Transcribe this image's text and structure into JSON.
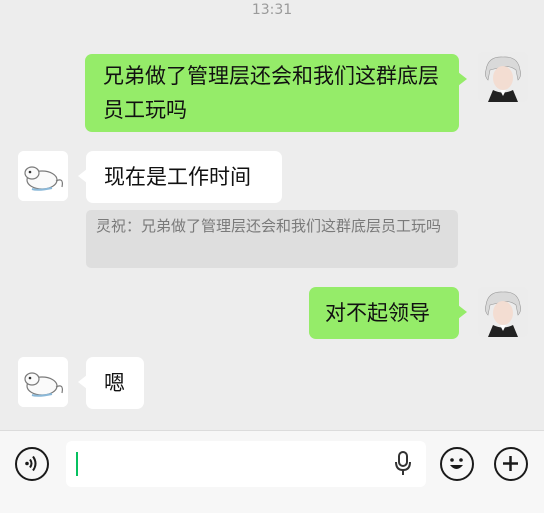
{
  "status_time": "13:31",
  "messages": [
    {
      "side": "right",
      "text": "兄弟做了管理层还会和我们这群底层员工玩吗"
    },
    {
      "side": "left",
      "text": "现在是工作时间"
    },
    {
      "side": "right",
      "text": "对不起领导"
    },
    {
      "side": "left",
      "text": "嗯"
    }
  ],
  "quote": {
    "text": "灵祝：兄弟做了管理层还会和我们这群底层员工玩吗"
  },
  "input_bar": {
    "value": "",
    "icons": [
      "voice-icon",
      "microphone-icon",
      "emoji-icon",
      "plus-icon"
    ]
  },
  "colors": {
    "background": "#ededed",
    "green_bubble": "#95ec69",
    "white_bubble": "#ffffff",
    "cursor": "#07c160"
  }
}
